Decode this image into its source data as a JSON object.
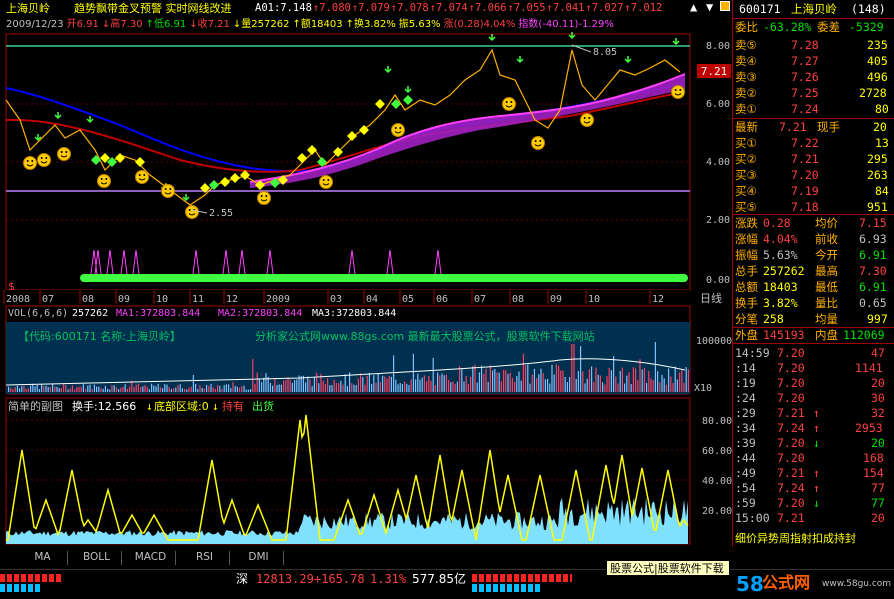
{
  "header": {
    "stock_name": "上海贝岭",
    "indicator_title": "趋势飘带金叉预警 实时网线改进",
    "line1_items": [
      {
        "t": "A01:7.148",
        "c": "#ffffff"
      },
      {
        "t": "↑7.080",
        "c": "#ff4040"
      },
      {
        "t": "↑7.079",
        "c": "#ff4040"
      },
      {
        "t": "↑7.078",
        "c": "#ff4040"
      },
      {
        "t": "↑7.074",
        "c": "#ff4040"
      },
      {
        "t": "↑7.066",
        "c": "#ff4040"
      },
      {
        "t": "↑7.055",
        "c": "#ff4040"
      },
      {
        "t": "↑7.041",
        "c": "#ff4040"
      },
      {
        "t": "↑7.027",
        "c": "#ff4040"
      },
      {
        "t": "↑7.012",
        "c": "#ff4040"
      }
    ],
    "line2_items": [
      {
        "t": "2009/12/23",
        "c": "#c0c0c0"
      },
      {
        "t": "开6.91",
        "c": "#ff4040"
      },
      {
        "t": "↓高7.30",
        "c": "#ff4040"
      },
      {
        "t": "↑低6.91",
        "c": "#00e000"
      },
      {
        "t": "↓收7.21",
        "c": "#ff4040"
      },
      {
        "t": "↓量257262",
        "c": "#ffff00"
      },
      {
        "t": "↑额18403",
        "c": "#ffff00"
      },
      {
        "t": "↑换3.82%",
        "c": "#ffff00"
      },
      {
        "t": "振5.63%",
        "c": "#ffff00"
      },
      {
        "t": "涨(0.28)4.04%",
        "c": "#ff4040"
      },
      {
        "t": "指数(-40.11)-1.29%",
        "c": "#ff40ff"
      }
    ]
  },
  "main_chart": {
    "y_labels": [
      "8.00",
      "7.21",
      "6.00",
      "4.00",
      "2.00",
      "0.00"
    ],
    "annotation_high": "8.05",
    "annotation_low": "2.55",
    "current_price": "7.21",
    "dollar_marker": "$",
    "x_labels": [
      "2008",
      "07",
      "08",
      "09",
      "10",
      "11",
      "12",
      "2009",
      "03",
      "04",
      "05",
      "06",
      "07",
      "08",
      "09",
      "10",
      "12"
    ],
    "period_label": "日线"
  },
  "volume_panel": {
    "label": "VOL(6,6,6)",
    "vol_value": "257262",
    "ma1": "MA1:372803.844",
    "ma2": "MA2:372803.844",
    "ma3": "MA3:372803.844",
    "code_banner": "【代码:600171 名称:上海贝岭】",
    "ad_text": "分析家公式网www.88gs.com 最新最大股票公式，股票软件下载网站",
    "y_label": "100000",
    "unit": "X10"
  },
  "sub_panel": {
    "title": "简单的副图",
    "turnover": "换手:12.566",
    "bottom_zone": "底部区域:0",
    "hold": "持有",
    "sell": "出货",
    "y_labels": [
      "80.00",
      "60.00",
      "40.00",
      "20.00"
    ]
  },
  "quote": {
    "code": "600171",
    "name": "上海贝岭",
    "count": "(148)",
    "ratio_label": "委比",
    "ratio": "-63.28%",
    "diff_label": "委差",
    "diff": "-5329",
    "asks": [
      {
        "l": "卖⑤",
        "p": "7.28",
        "v": "235"
      },
      {
        "l": "卖④",
        "p": "7.27",
        "v": "405"
      },
      {
        "l": "卖③",
        "p": "7.26",
        "v": "496"
      },
      {
        "l": "卖②",
        "p": "7.25",
        "v": "2728"
      },
      {
        "l": "卖①",
        "p": "7.24",
        "v": "80"
      }
    ],
    "latest_label": "最新",
    "latest": "7.21",
    "hand_label": "现手",
    "hand": "20",
    "bids": [
      {
        "l": "买①",
        "p": "7.22",
        "v": "13"
      },
      {
        "l": "买②",
        "p": "7.21",
        "v": "295"
      },
      {
        "l": "买③",
        "p": "7.20",
        "v": "263"
      },
      {
        "l": "买④",
        "p": "7.19",
        "v": "84"
      },
      {
        "l": "买⑤",
        "p": "7.18",
        "v": "951"
      }
    ],
    "stats": [
      {
        "l1": "涨跌",
        "v1": "0.28",
        "c1": "#ff4040",
        "l2": "均价",
        "v2": "7.15",
        "c2": "#ff4040"
      },
      {
        "l1": "涨幅",
        "v1": "4.04%",
        "c1": "#ff4040",
        "l2": "前收",
        "v2": "6.93",
        "c2": "#c0c0c0"
      },
      {
        "l1": "振幅",
        "v1": "5.63%",
        "c1": "#c0c0c0",
        "l2": "今开",
        "v2": "6.91",
        "c2": "#00e000"
      },
      {
        "l1": "总手",
        "v1": "257262",
        "c1": "#ffff00",
        "l2": "最高",
        "v2": "7.30",
        "c2": "#ff4040"
      },
      {
        "l1": "总额",
        "v1": "18403",
        "c1": "#ffff00",
        "l2": "最低",
        "v2": "6.91",
        "c2": "#00e000"
      },
      {
        "l1": "换手",
        "v1": "3.82%",
        "c1": "#ffff00",
        "l2": "量比",
        "v2": "0.65",
        "c2": "#c0c0c0"
      },
      {
        "l1": "分笔",
        "v1": "258",
        "c1": "#ffff00",
        "l2": "均量",
        "v2": "997",
        "c2": "#ffff00"
      }
    ],
    "outer_label": "外盘",
    "outer": "145193",
    "inner_label": "内盘",
    "inner": "112069",
    "ticks": [
      {
        "t": "14:59",
        "p": "7.20",
        "a": "",
        "v": "47",
        "ac": "#ff4040",
        "vc": "#ff4040"
      },
      {
        "t": ":14",
        "p": "7.20",
        "a": "",
        "v": "1141",
        "ac": "#ff4040",
        "vc": "#ff4040"
      },
      {
        "t": ":19",
        "p": "7.20",
        "a": "",
        "v": "20",
        "ac": "#ff4040",
        "vc": "#ff4040"
      },
      {
        "t": ":24",
        "p": "7.20",
        "a": "",
        "v": "30",
        "ac": "#ff4040",
        "vc": "#ff4040"
      },
      {
        "t": ":29",
        "p": "7.21",
        "a": "↑",
        "v": "32",
        "ac": "#ff4040",
        "vc": "#ff4040"
      },
      {
        "t": ":34",
        "p": "7.24",
        "a": "↑",
        "v": "2953",
        "ac": "#ff4040",
        "vc": "#ff4040"
      },
      {
        "t": ":39",
        "p": "7.20",
        "a": "↓",
        "v": "20",
        "ac": "#00e000",
        "vc": "#00e000"
      },
      {
        "t": ":44",
        "p": "7.20",
        "a": "",
        "v": "168",
        "ac": "#ff4040",
        "vc": "#ff4040"
      },
      {
        "t": ":49",
        "p": "7.21",
        "a": "↑",
        "v": "154",
        "ac": "#ff4040",
        "vc": "#ff4040"
      },
      {
        "t": ":54",
        "p": "7.24",
        "a": "↑",
        "v": "77",
        "ac": "#ff4040",
        "vc": "#ff4040"
      },
      {
        "t": ":59",
        "p": "7.20",
        "a": "↓",
        "v": "77",
        "ac": "#00e000",
        "vc": "#00e000"
      },
      {
        "t": "15:00",
        "p": "7.21",
        "a": "",
        "v": "20",
        "ac": "#ff4040",
        "vc": "#ff4040"
      }
    ],
    "bottom_note": "细价异势周指射扣成持封"
  },
  "tabs": [
    "MA",
    "BOLL",
    "MACD",
    "RSI",
    "DMI"
  ],
  "status": {
    "market": "深",
    "index": "12813.29",
    "change": "+165.78",
    "pct": "1.31%",
    "amount": "577.85亿",
    "tooltip": "股票公式|股票软件下载",
    "logo_num": "58",
    "logo_text": "公式网",
    "url": "www.58gu.com"
  }
}
